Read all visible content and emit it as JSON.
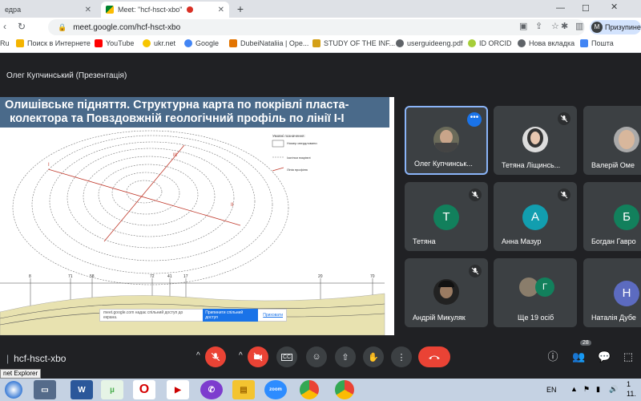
{
  "tabs": [
    {
      "label": "едра"
    },
    {
      "label": "Meet: \"hcf-hsct-xbo\""
    }
  ],
  "address": {
    "url": "meet.google.com/hcf-hsct-xbo"
  },
  "profile": {
    "initial": "M",
    "label": "Призупине"
  },
  "bookmarks": [
    {
      "label": "Ru",
      "color": "#1a73e8"
    },
    {
      "label": "Поиск в Интернете",
      "color": "#f4b400"
    },
    {
      "label": "YouTube",
      "color": "#ff0000"
    },
    {
      "label": "ukr.net",
      "color": "#f7c600"
    },
    {
      "label": "Google",
      "color": "#4285f4"
    },
    {
      "label": "DubeiNataliia | Ope...",
      "color": "#e37400"
    },
    {
      "label": "STUDY OF THE INF...",
      "color": "#d4a017"
    },
    {
      "label": "userguideeng.pdf",
      "color": "#5f6368"
    },
    {
      "label": "ID ORCID",
      "color": "#a6ce39"
    },
    {
      "label": "Нова вкладка",
      "color": "#5f6368"
    },
    {
      "label": "Пошта",
      "color": "#4285f4"
    }
  ],
  "presenter": {
    "label": "Олег Купчинський (Презентація)"
  },
  "slide": {
    "title_line1": "Олишівське підняття. Структурна карта по покрівлі пласта-",
    "title_line2": "колектора та Повздовжній геологічний профіль по лінії І-І",
    "legend_title": "Умовні позначення:",
    "legend_items": [
      "Номер свердловини",
      "Ізогіпси покрівлі",
      "Лінія профілю"
    ],
    "well_labels": [
      "8",
      "71",
      "58",
      "72",
      "41",
      "17",
      "20",
      "70"
    ],
    "map_marks": [
      "I",
      "II",
      "III"
    ],
    "share_banner": {
      "text": "meet.google.com надає спільний доступ до екрана.",
      "stop_label": "Припинити спільний доступ",
      "hide_label": "Приховати"
    }
  },
  "participants": [
    {
      "name": "Олег Купчинськ...",
      "type": "photo",
      "speaking": true,
      "muted": false
    },
    {
      "name": "Тетяна Ліщинсь...",
      "type": "photo",
      "muted": true
    },
    {
      "name": "Валерій Оме",
      "type": "photo",
      "muted": false
    },
    {
      "name": "Тетяна",
      "type": "letter",
      "letter": "Т",
      "color": "#12805c",
      "muted": true
    },
    {
      "name": "Анна Мазур",
      "type": "letter",
      "letter": "А",
      "color": "#129eaf",
      "muted": true
    },
    {
      "name": "Богдан Гавро",
      "type": "letter",
      "letter": "Б",
      "color": "#12805c",
      "muted": false
    },
    {
      "name": "Андрій Микуляк",
      "type": "photo",
      "muted": true
    },
    {
      "name": "Ще 19 осіб",
      "type": "group",
      "letter": "Г",
      "muted": false
    },
    {
      "name": "Наталія Дубе",
      "type": "letter",
      "letter": "Н",
      "color": "#5c6bc0",
      "muted": false
    }
  ],
  "meeting": {
    "code": "hcf-hsct-xbo",
    "participant_count": "28"
  },
  "taskbar": {
    "tooltip": "net Explorer",
    "lang": "EN",
    "time": "1",
    "date": "11."
  },
  "colors": {
    "accent": "#1a73e8",
    "danger": "#ea4335",
    "surface": "#3c4043",
    "background": "#202124"
  }
}
